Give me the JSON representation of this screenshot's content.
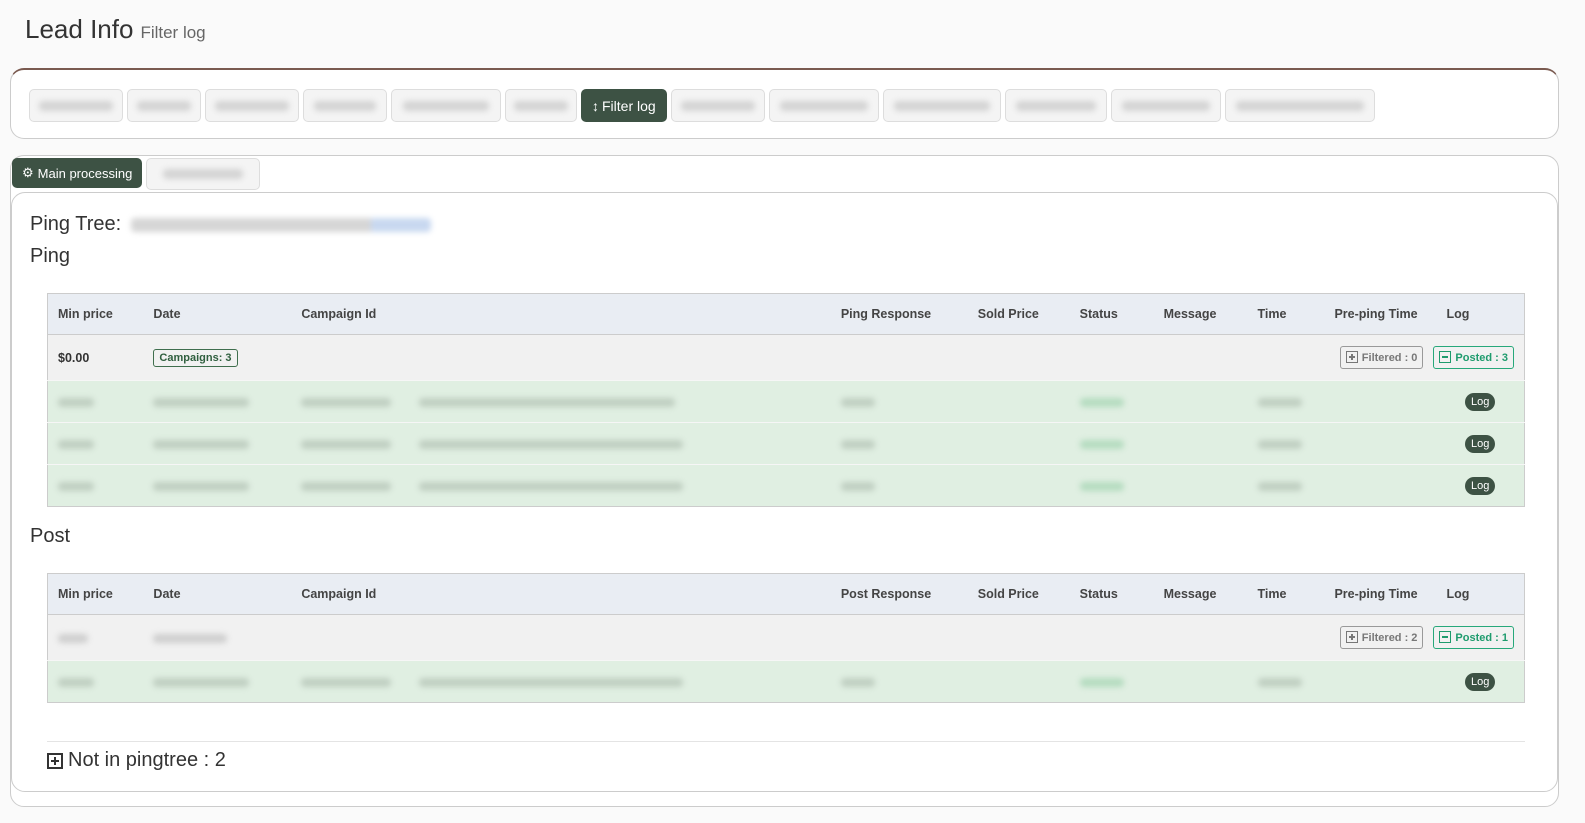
{
  "header": {
    "title": "Lead Info",
    "subtitle": "Filter log"
  },
  "top_tabs": {
    "active_label": "Filter log",
    "active_icon": "up-down-arrow-icon"
  },
  "sub_tabs": {
    "active_label": "Main processing",
    "active_icon": "gears-icon"
  },
  "ping_tree_label": "Ping Tree:",
  "ping": {
    "title": "Ping",
    "columns": [
      "Min price",
      "Date",
      "Campaign Id",
      "Ping Response",
      "Sold Price",
      "Status",
      "Message",
      "Time",
      "Pre-ping Time",
      "Log"
    ],
    "summary": {
      "min_price": "$0.00",
      "campaigns_badge": "Campaigns: 3",
      "filtered": "Filtered : 0",
      "posted": "Posted : 3"
    },
    "rows": [
      {
        "log": "Log"
      },
      {
        "log": "Log"
      },
      {
        "log": "Log"
      }
    ]
  },
  "post": {
    "title": "Post",
    "columns": [
      "Min price",
      "Date",
      "Campaign Id",
      "Post Response",
      "Sold Price",
      "Status",
      "Message",
      "Time",
      "Pre-ping Time",
      "Log"
    ],
    "summary": {
      "filtered": "Filtered : 2",
      "posted": "Posted : 1"
    },
    "rows": [
      {
        "log": "Log"
      }
    ]
  },
  "not_in_pingtree": "Not in pingtree : 2",
  "colors": {
    "accent": "#3d5244",
    "header_border": "#7a5a50",
    "row_success": "#e0efe2",
    "posted": "#1e9b6d"
  }
}
